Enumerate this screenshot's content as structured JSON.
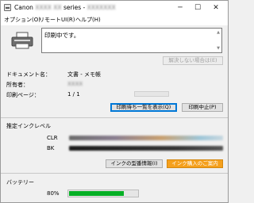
{
  "window": {
    "title_prefix": "Canon",
    "title_hidden": "XXXX XX",
    "title_suffix": "series -",
    "title_hidden2": "XXXXXXX",
    "minimize_glyph": "─",
    "maximize_glyph": "☐",
    "close_glyph": "✕"
  },
  "menu": {
    "options": "オプション(O)",
    "remote_ui": "リモートUI(R)",
    "help": "ヘルプ(H)"
  },
  "status": {
    "message": "印刷中です。",
    "unresolved_button": "解決しない場合は(E)"
  },
  "job": {
    "document_label": "ドキュメント名：",
    "document_value": "文書 - メモ帳",
    "owner_label": "所有者：",
    "owner_value": "XXXX",
    "pages_label": "印刷ページ：",
    "pages_value": "1 / 1",
    "show_queue_button": "印刷待ち一覧を表示(Q)",
    "cancel_button": "印刷中止(P)"
  },
  "ink": {
    "section_title": "推定インクレベル",
    "clr_label": "CLR",
    "bk_label": "BK",
    "model_info_button": "インクの型番情報(I)",
    "purchase_button": "インク購入のご案内"
  },
  "battery": {
    "section_title": "バッテリー",
    "percent_text": "80%",
    "level_fraction": 0.8
  },
  "colors": {
    "accent": "#0078d7",
    "purchase": "#f5a01c",
    "battery_fill": "#06b025"
  }
}
